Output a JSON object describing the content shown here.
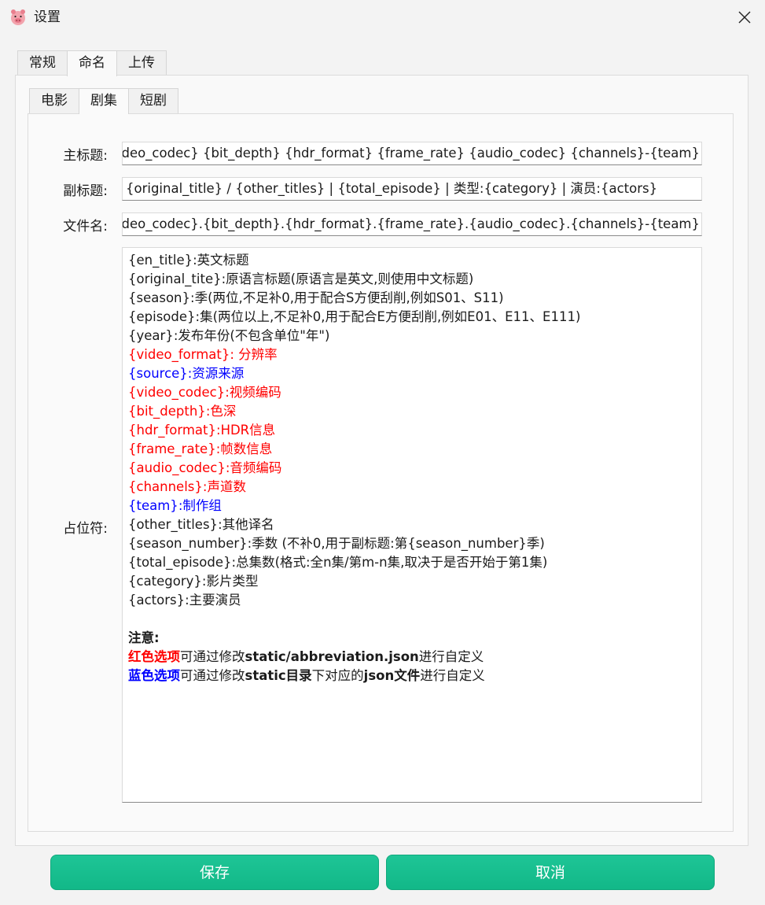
{
  "window": {
    "title": "设置",
    "app_icon": "pig-face-icon",
    "close_icon": "close-icon"
  },
  "outer_tabs": [
    "常规",
    "命名",
    "上传"
  ],
  "inner_tabs": [
    "电影",
    "剧集",
    "短剧"
  ],
  "form": {
    "main_title_label": "主标题:",
    "main_title_value": "{en_title} {season}{year} {video_format} {source} {video_codec} {bit_depth} {hdr_format} {frame_rate} {audio_codec} {channels}-{team}",
    "subtitle_label": "副标题:",
    "subtitle_value": "{original_title} / {other_titles} | {total_episode} | 类型:{category} | 演员:{actors}",
    "filename_label": "文件名:",
    "filename_value": "{en_title}.{season}.{year}.{video_format}.{source}.{video_codec}.{bit_depth}.{hdr_format}.{frame_rate}.{audio_codec}.{channels}-{team}",
    "placeholder_label": "占位符:"
  },
  "placeholders": [
    {
      "key": "{en_title}",
      "desc": ":英文标题",
      "color": "default"
    },
    {
      "key": "{original_tite}",
      "desc": ":原语言标题(原语言是英文,则使用中文标题)",
      "color": "default"
    },
    {
      "key": "{season}",
      "desc": ":季(两位,不足补0,用于配合S方便刮削,例如S01、S11)",
      "color": "default"
    },
    {
      "key": "{episode}",
      "desc": ":集(两位以上,不足补0,用于配合E方便刮削,例如E01、E11、E111)",
      "color": "default"
    },
    {
      "key": "{year}",
      "desc": ":发布年份(不包含单位\"年\")",
      "color": "default"
    },
    {
      "key": "{video_format}",
      "desc": ": 分辨率",
      "color": "red"
    },
    {
      "key": "{source}",
      "desc": ":资源来源",
      "color": "blue"
    },
    {
      "key": "{video_codec}",
      "desc": ":视频编码",
      "color": "red"
    },
    {
      "key": "{bit_depth}",
      "desc": ":色深",
      "color": "red"
    },
    {
      "key": "{hdr_format}",
      "desc": ":HDR信息",
      "color": "red"
    },
    {
      "key": "{frame_rate}",
      "desc": ":帧数信息",
      "color": "red"
    },
    {
      "key": "{audio_codec}",
      "desc": ":音频编码",
      "color": "red"
    },
    {
      "key": "{channels}",
      "desc": ":声道数",
      "color": "red"
    },
    {
      "key": "{team}",
      "desc": ":制作组",
      "color": "blue"
    },
    {
      "key": "{other_titles}",
      "desc": ":其他译名",
      "color": "default"
    },
    {
      "key": "{season_number}",
      "desc": ":季数 (不补0,用于副标题:第{season_number}季)",
      "color": "default"
    },
    {
      "key": "{total_episode}",
      "desc": ":总集数(格式:全n集/第m-n集,取决于是否开始于第1集)",
      "color": "default"
    },
    {
      "key": "{category}",
      "desc": ":影片类型",
      "color": "default"
    },
    {
      "key": "{actors}",
      "desc": ":主要演员",
      "color": "default"
    }
  ],
  "notes": {
    "title": "注意:",
    "red_line": {
      "highlight": "红色选项",
      "text1": "可通过修改",
      "bold1": "static/abbreviation.json",
      "text2": "进行自定义"
    },
    "blue_line": {
      "highlight": "蓝色选项",
      "text1": "可通过修改",
      "bold1": "static目录",
      "text2": "下对应的",
      "bold2": "json文件",
      "text3": "进行自定义"
    }
  },
  "buttons": {
    "save": "保存",
    "cancel": "取消"
  },
  "colors": {
    "accent": "#16bd8d",
    "red": "#ff0000",
    "blue": "#0000ff"
  }
}
